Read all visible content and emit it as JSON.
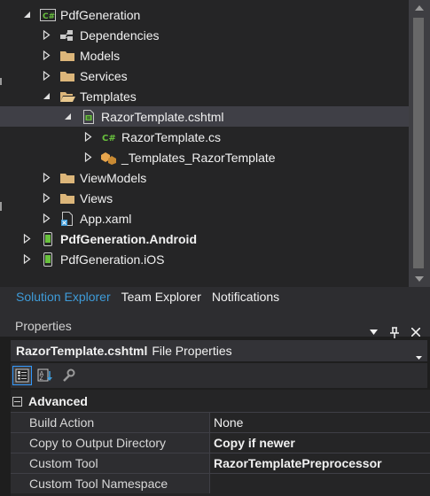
{
  "explorer": {
    "items": [
      {
        "label": "PdfGeneration",
        "icon": "csharp-project-icon",
        "expanded": true
      },
      {
        "label": "Dependencies",
        "icon": "dependencies-icon",
        "expanded": false
      },
      {
        "label": "Models",
        "icon": "folder-icon",
        "expanded": false
      },
      {
        "label": "Services",
        "icon": "folder-icon",
        "expanded": false
      },
      {
        "label": "Templates",
        "icon": "folder-icon",
        "expanded": true
      },
      {
        "label": "RazorTemplate.cshtml",
        "icon": "cshtml-file-icon",
        "expanded": true,
        "selected": true
      },
      {
        "label": "RazorTemplate.cs",
        "icon": "csharp-file-icon",
        "expanded": false
      },
      {
        "label": "_Templates_RazorTemplate",
        "icon": "class-icon",
        "expanded": false
      },
      {
        "label": "ViewModels",
        "icon": "folder-icon",
        "expanded": false
      },
      {
        "label": "Views",
        "icon": "folder-icon",
        "expanded": false
      },
      {
        "label": "App.xaml",
        "icon": "xaml-file-icon",
        "expanded": false
      },
      {
        "label": "PdfGeneration.Android",
        "icon": "android-project-icon",
        "expanded": false,
        "bold": true
      },
      {
        "label": "PdfGeneration.iOS",
        "icon": "ios-project-icon",
        "expanded": false
      }
    ]
  },
  "tabs": [
    {
      "label": "Solution Explorer",
      "active": true
    },
    {
      "label": "Team Explorer",
      "active": false
    },
    {
      "label": "Notifications",
      "active": false
    }
  ],
  "properties": {
    "title": "Properties",
    "object_name": "RazorTemplate.cshtml",
    "object_type": "File Properties",
    "category": "Advanced",
    "rows": [
      {
        "name": "Build Action",
        "value": "None",
        "bold": false
      },
      {
        "name": "Copy to Output Directory",
        "value": "Copy if newer",
        "bold": true
      },
      {
        "name": "Custom Tool",
        "value": "RazorTemplatePreprocessor",
        "bold": true
      },
      {
        "name": "Custom Tool Namespace",
        "value": "",
        "bold": false
      }
    ]
  },
  "colors": {
    "accent": "#3e9bd8",
    "folder": "#dcb67a",
    "csharp": "#68c13d",
    "background": "#252526"
  }
}
